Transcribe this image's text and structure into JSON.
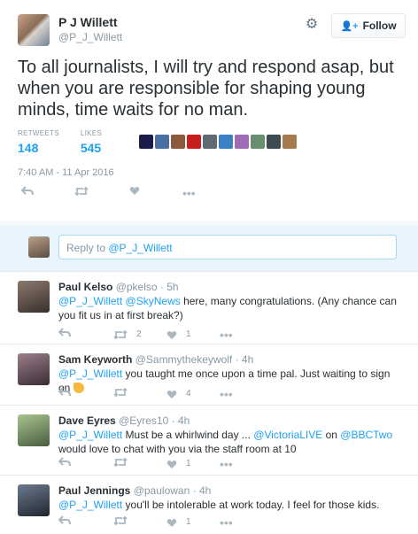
{
  "tweet": {
    "author_name": "P J Willett",
    "author_handle": "@P_J_Willett",
    "follow_label": "Follow",
    "text": "To all journalists, I will try and respond asap, but when you are responsible for shaping young minds, time waits for no man.",
    "retweets_label": "RETWEETS",
    "retweets": "148",
    "likes_label": "LIKES",
    "likes": "545",
    "liker_colors": [
      "#1b1b4a",
      "#4a6fa5",
      "#8b5a3c",
      "#c81e1e",
      "#606a74",
      "#3b7fc4",
      "#9f6bb6",
      "#6a8f6e",
      "#3f4a52",
      "#a57a4c"
    ],
    "timestamp": "7:40 AM - 11 Apr 2016"
  },
  "reply_box": {
    "prefix": "Reply to ",
    "mention": "@P_J_Willett"
  },
  "replies": [
    {
      "name": "Paul Kelso",
      "handle": "@pkelso",
      "time": "· 5h",
      "mention1": "@P_J_Willett",
      "mention2": "@SkyNews",
      "text_after": " here, many congratulations. (Any chance can you fit us in at first break?)",
      "retweets": "2",
      "likes": "1",
      "avatar_color": "#5a4e47"
    },
    {
      "name": "Sam Keyworth",
      "handle": "@Sammythekeywolf",
      "time": "· 4h",
      "mention1": "@P_J_Willett",
      "text_after": " you taught me once upon a time pal. Just waiting to sign on ",
      "likes": "4",
      "avatar_color": "#7a5f6a"
    },
    {
      "name": "Dave Eyres",
      "handle": "@Eyres10",
      "time": "· 4h",
      "mention1": "@P_J_Willett",
      "text_mid1": " Must be a whirlwind day ... ",
      "mention2": "@VictoriaLIVE",
      "text_mid2": " on ",
      "mention3": "@BBCTwo",
      "text_after": " would love to chat with you via the staff room at 10",
      "likes": "1",
      "avatar_color": "#7b9a6a"
    },
    {
      "name": "Paul Jennings",
      "handle": "@paulowan",
      "time": "· 4h",
      "mention1": "@P_J_Willett",
      "text_after": " you'll be intolerable at work today. I feel for those kids.",
      "likes": "1",
      "avatar_color": "#3d4a5c"
    }
  ],
  "icons": {
    "reply": "reply-icon",
    "retweet": "retweet-icon",
    "like": "heart-icon",
    "more": "more-icon",
    "gear": "gear-icon",
    "follow": "follow-user-icon"
  }
}
